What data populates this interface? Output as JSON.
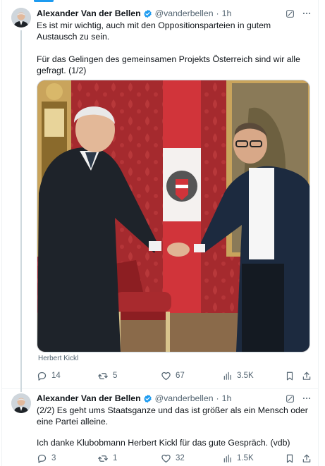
{
  "tweets": [
    {
      "author": {
        "name": "Alexander Van der Bellen",
        "handle": "@vanderbellen",
        "verified": true
      },
      "time": "1h",
      "paragraphs": [
        "Es ist mir wichtig, auch mit den Oppositionsparteien in gutem Austausch zu sein.",
        "Für das Gelingen des gemeinsamen Projekts Österreich sind wir alle gefragt. (1/2)"
      ],
      "media": {
        "caption": "Herbert Kickl",
        "alt_icon": "photo"
      },
      "stats": {
        "replies": "14",
        "reposts": "5",
        "likes": "67",
        "views": "3.5K"
      }
    },
    {
      "author": {
        "name": "Alexander Van der Bellen",
        "handle": "@vanderbellen",
        "verified": true
      },
      "time": "1h",
      "paragraphs": [
        "(2/2) Es geht ums Staatsganze und das ist größer als ein Mensch oder eine Partei alleine.",
        "Ich danke Klubobmann Herbert Kickl für das gute Gespräch. (vdb)"
      ],
      "stats": {
        "replies": "3",
        "reposts": "1",
        "likes": "32",
        "views": "1.5K"
      }
    }
  ],
  "separator": "·",
  "icons": {
    "grok": "grok-icon",
    "more": "more-icon",
    "reply": "reply-icon",
    "repost": "repost-icon",
    "like": "like-icon",
    "views": "views-icon",
    "bookmark": "bookmark-icon",
    "share": "share-icon",
    "verified": "verified-badge-icon"
  },
  "colors": {
    "accent": "#1d9bf0",
    "text": "#0f1419",
    "muted": "#536471",
    "border": "#cfd9de"
  }
}
